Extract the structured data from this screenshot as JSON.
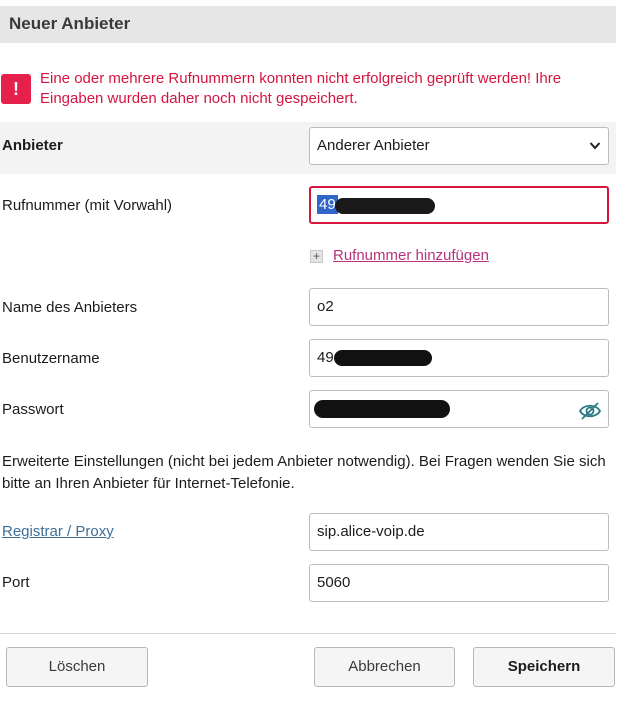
{
  "header": {
    "title": "Neuer Anbieter"
  },
  "error": {
    "icon": "!",
    "line1": "Eine oder mehrere Rufnummern konnten nicht erfolgreich geprüft werden! Ihre",
    "line2": "Eingaben wurden daher noch nicht gespeichert."
  },
  "form": {
    "provider": {
      "label": "Anbieter",
      "selected": "Anderer Anbieter"
    },
    "phone": {
      "label": "Rufnummer (mit Vorwahl)",
      "visible_prefix": "49"
    },
    "add_number": {
      "label": "Rufnummer hinzufügen"
    },
    "provider_name": {
      "label": "Name des Anbieters",
      "value": "o2"
    },
    "username": {
      "label": "Benutzername",
      "visible_prefix": "49"
    },
    "password": {
      "label": "Passwort"
    },
    "advanced_text": "Erweiterte Einstellungen (nicht bei jedem Anbieter notwendig). Bei Fragen wenden Sie sich bitte an Ihren Anbieter für Internet-Telefonie.",
    "registrar": {
      "label": "Registrar / Proxy",
      "value": "sip.alice-voip.de"
    },
    "port": {
      "label": "Port",
      "value": "5060"
    }
  },
  "buttons": {
    "delete": "Löschen",
    "cancel": "Abbrechen",
    "save": "Speichern"
  },
  "colors": {
    "error": "#d6153f",
    "error_icon_bg": "#e5204b",
    "link": "#3e6f9a",
    "add_link": "#b8337d",
    "header_bg": "#e6e6e6",
    "icon_accent": "#2a7a84"
  },
  "icons": {
    "error": "exclamation-icon",
    "select": "chevron-down-icon",
    "add": "plus-icon",
    "password_toggle": "eye-slash-icon"
  }
}
